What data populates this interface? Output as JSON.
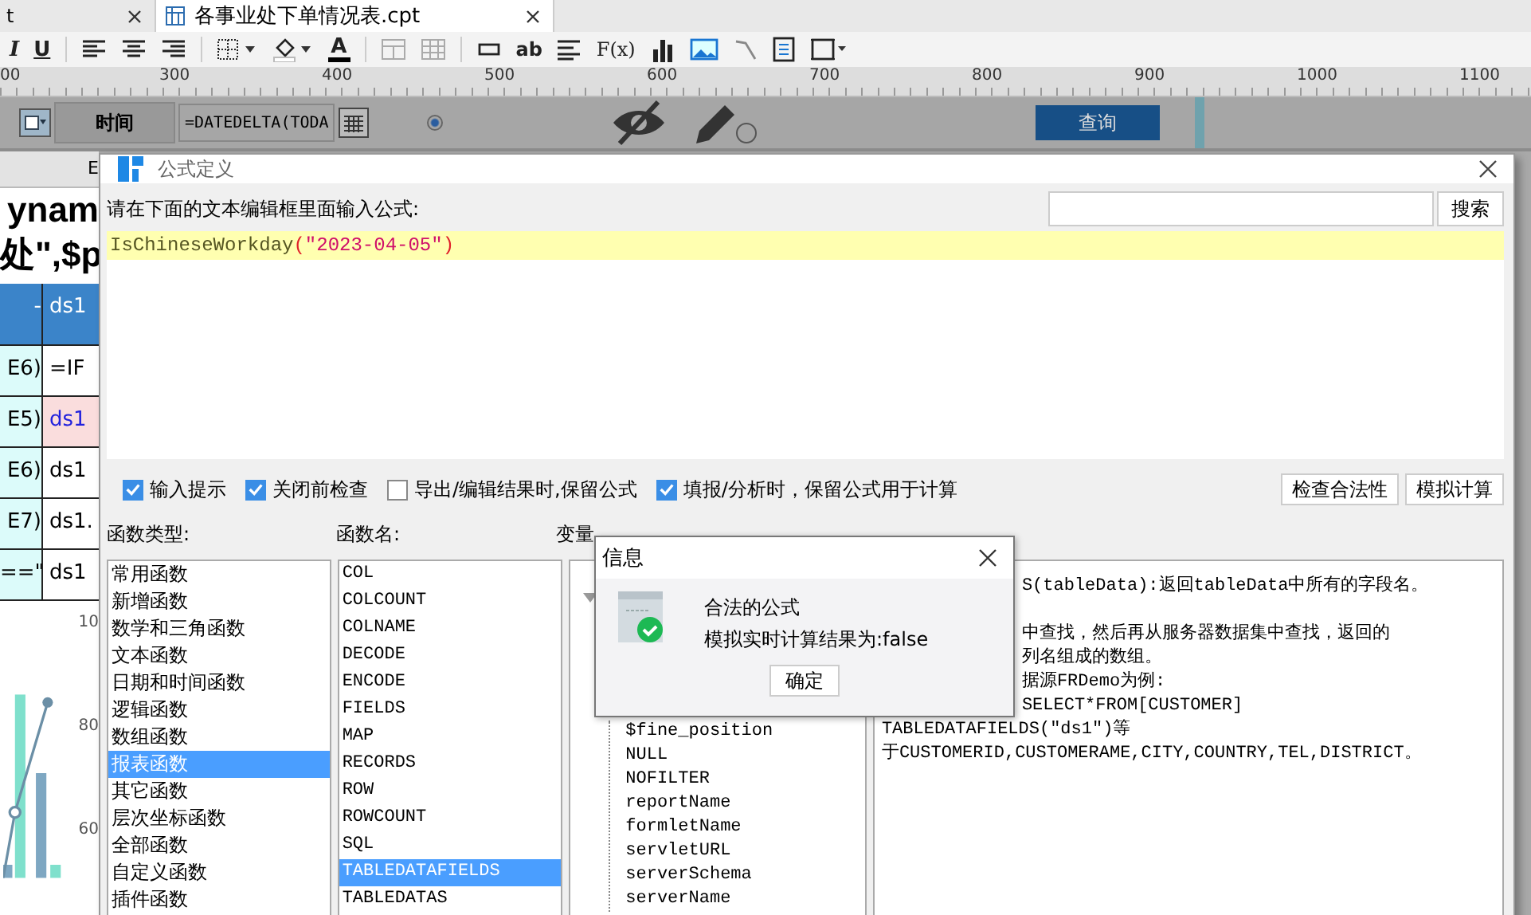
{
  "app_tabs": [
    {
      "label": "t",
      "selected": false
    },
    {
      "label": "各事业处下单情况表.cpt",
      "selected": true
    }
  ],
  "toolbar": [
    {
      "kind": "italic",
      "label": "I"
    },
    {
      "kind": "underline",
      "label": "U"
    },
    {
      "kind": "sep"
    },
    {
      "kind": "align-left"
    },
    {
      "kind": "align-center"
    },
    {
      "kind": "align-right"
    },
    {
      "kind": "sep"
    },
    {
      "kind": "border"
    },
    {
      "kind": "fill"
    },
    {
      "kind": "font-color",
      "label": "A"
    },
    {
      "kind": "sep"
    },
    {
      "kind": "merge"
    },
    {
      "kind": "grid"
    },
    {
      "kind": "sep"
    },
    {
      "kind": "field"
    },
    {
      "kind": "text",
      "label": "ab"
    },
    {
      "kind": "lines"
    },
    {
      "kind": "formula",
      "label": "F(x)"
    },
    {
      "kind": "bar-chart"
    },
    {
      "kind": "image"
    },
    {
      "kind": "slash"
    },
    {
      "kind": "document"
    },
    {
      "kind": "frame"
    }
  ],
  "ruler_labels": [
    "00",
    "300",
    "400",
    "500",
    "600",
    "700",
    "800",
    "900",
    "1000",
    "1100"
  ],
  "param_bar": {
    "label": "时间",
    "date_value": "=DATEDELTA(TODA",
    "radio_selected": true,
    "query_button": "查询"
  },
  "sheet": {
    "column_header": "E",
    "title_lines": [
      "ynam",
      "处\",$p"
    ],
    "header_row": {
      "left": "-",
      "right": "ds1"
    },
    "rows": [
      {
        "left": "E6)",
        "right": "=IF",
        "highlight": false
      },
      {
        "left": "E5)",
        "right": "ds1",
        "highlight": true
      },
      {
        "left": "E6)",
        "right": "ds1",
        "highlight": false
      },
      {
        "left": "E7)",
        "right": "ds1.",
        "highlight": false
      },
      {
        "left": "==\"",
        "right": "ds1",
        "highlight": false
      }
    ],
    "chart_axis_labels": [
      "10",
      "80",
      "60"
    ]
  },
  "dialog": {
    "title": "公式定义",
    "instruction": "请在下面的文本编辑框里面输入公式:",
    "search_button": "搜索",
    "formula": "IsChineseWorkday(\"2023-04-05\")",
    "options": [
      {
        "label": "输入提示",
        "checked": true
      },
      {
        "label": "关闭前检查",
        "checked": true
      },
      {
        "label": "导出/编辑结果时,保留公式",
        "checked": false
      },
      {
        "label": "填报/分析时，保留公式用于计算",
        "checked": true
      }
    ],
    "buttons": [
      "检查合法性",
      "模拟计算"
    ],
    "category_heading": "函数类型:",
    "function_heading": "函数名:",
    "variable_heading": "变量",
    "categories": [
      {
        "label": "常用函数",
        "selected": false
      },
      {
        "label": "新增函数",
        "selected": false
      },
      {
        "label": "数学和三角函数",
        "selected": false
      },
      {
        "label": "文本函数",
        "selected": false
      },
      {
        "label": "日期和时间函数",
        "selected": false
      },
      {
        "label": "逻辑函数",
        "selected": false
      },
      {
        "label": "数组函数",
        "selected": false
      },
      {
        "label": "报表函数",
        "selected": true
      },
      {
        "label": "其它函数",
        "selected": false
      },
      {
        "label": "层次坐标函数",
        "selected": false
      },
      {
        "label": "全部函数",
        "selected": false
      },
      {
        "label": "自定义函数",
        "selected": false
      },
      {
        "label": "插件函数",
        "selected": false
      }
    ],
    "functions": [
      {
        "label": "COL",
        "selected": false
      },
      {
        "label": "COLCOUNT",
        "selected": false
      },
      {
        "label": "COLNAME",
        "selected": false
      },
      {
        "label": "DECODE",
        "selected": false
      },
      {
        "label": "ENCODE",
        "selected": false
      },
      {
        "label": "FIELDS",
        "selected": false
      },
      {
        "label": "MAP",
        "selected": false
      },
      {
        "label": "RECORDS",
        "selected": false
      },
      {
        "label": "ROW",
        "selected": false
      },
      {
        "label": "ROWCOUNT",
        "selected": false
      },
      {
        "label": "SQL",
        "selected": false
      },
      {
        "label": "TABLEDATAFIELDS",
        "selected": true
      },
      {
        "label": "TABLEDATAS",
        "selected": false
      }
    ],
    "variables": [
      "$fine_position",
      "NULL",
      "NOFILTER",
      "reportName",
      "formletName",
      "servletURL",
      "serverSchema",
      "serverName"
    ],
    "description": [
      {
        "text": "S(tableData):返回tableData中所有的字段名。",
        "covered": true
      },
      {
        "text": "中查找，然后再从服务器数据集中查找，返回的",
        "covered": true
      },
      {
        "text": "列名组成的数组。",
        "covered": true
      },
      {
        "text": "据源FRDemo为例:",
        "covered": true
      },
      {
        "text": "SELECT*FROM[CUSTOMER]",
        "covered": true
      },
      {
        "text": "TABLEDATAFIELDS(\"ds1\")等",
        "covered": false
      },
      {
        "text": "于CUSTOMERID,CUSTOMERAME,CITY,COUNTRY,TEL,DISTRICT。",
        "covered": false
      }
    ]
  },
  "info_dialog": {
    "title": "信息",
    "lines": [
      "合法的公式",
      "模拟实时计算结果为:false"
    ],
    "ok_button": "确定"
  }
}
